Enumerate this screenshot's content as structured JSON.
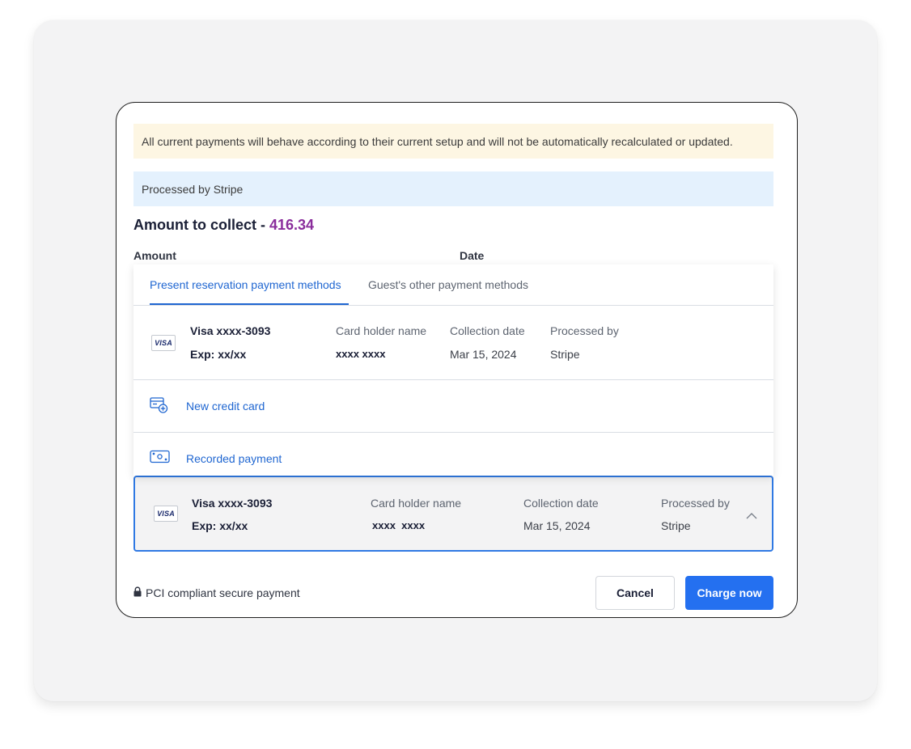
{
  "notice": {
    "text": "All current payments will behave according to their current setup and will not be automatically recalculated or updated."
  },
  "processor_banner": {
    "text": "Processed by Stripe"
  },
  "amount": {
    "title": "Amount to collect - ",
    "value": "416.34"
  },
  "fields": {
    "amount_label": "Amount",
    "date_label": "Date"
  },
  "dropdown": {
    "tabs": [
      {
        "label": "Present reservation payment methods",
        "active": true
      },
      {
        "label": "Guest's other payment methods",
        "active": false
      }
    ],
    "card": {
      "brand": "VISA",
      "name": "Visa xxxx-3093",
      "exp": "Exp: xx/xx",
      "holder_label": "Card holder name",
      "holder_value": "xxxx xxxx",
      "date_label": "Collection date",
      "date_value": "Mar 15, 2024",
      "processor_label": "Processed by",
      "processor_value": "Stripe"
    },
    "actions": [
      {
        "label": "New credit card",
        "icon": "credit-card-add-icon"
      },
      {
        "label": "Recorded payment",
        "icon": "cash-icon"
      }
    ]
  },
  "selected_card": {
    "brand": "VISA",
    "name": "Visa xxxx-3093",
    "exp": "Exp: xx/xx",
    "holder_label": "Card holder name",
    "holder_value": "xxxx  xxxx",
    "date_label": "Collection date",
    "date_value": "Mar 15, 2024",
    "processor_label": "Processed by",
    "processor_value": "Stripe",
    "toggle_icon": "chevron-up-icon"
  },
  "footer": {
    "pci_text": "PCI compliant secure payment",
    "cancel_label": "Cancel",
    "charge_label": "Charge now"
  },
  "colors": {
    "accent": "#2470f0",
    "amount_value": "#8a2d9c",
    "notice_bg": "#fdf6e3",
    "banner_bg": "#e4f1fd"
  }
}
